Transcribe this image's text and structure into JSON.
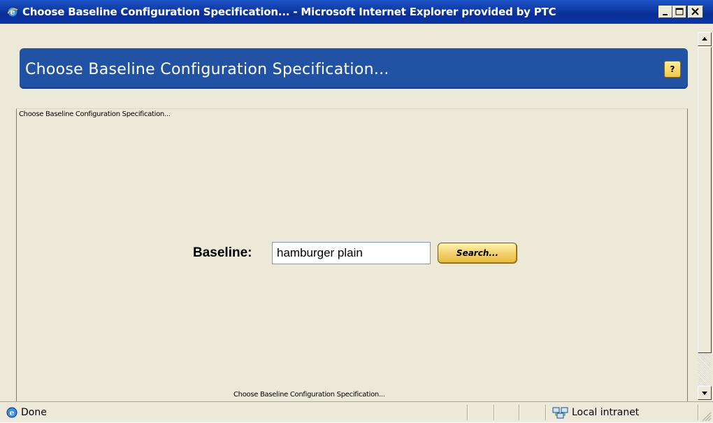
{
  "window": {
    "title": "Choose Baseline Configuration Specification... - Microsoft Internet Explorer provided by PTC"
  },
  "header": {
    "title": "Choose Baseline Configuration Specification...",
    "help_label": "?"
  },
  "panel": {
    "caption_top": "Choose Baseline Configuration Specification...",
    "caption_bottom": "Choose Baseline Configuration Specification..."
  },
  "form": {
    "baseline_label": "Baseline:",
    "baseline_value": "hamburger plain",
    "search_label": "Search..."
  },
  "statusbar": {
    "status": "Done",
    "zone": "Local intranet"
  },
  "colors": {
    "banner": "#2252a3",
    "titlebar": "#0a2e96",
    "button_gold": "#f1d06a"
  }
}
